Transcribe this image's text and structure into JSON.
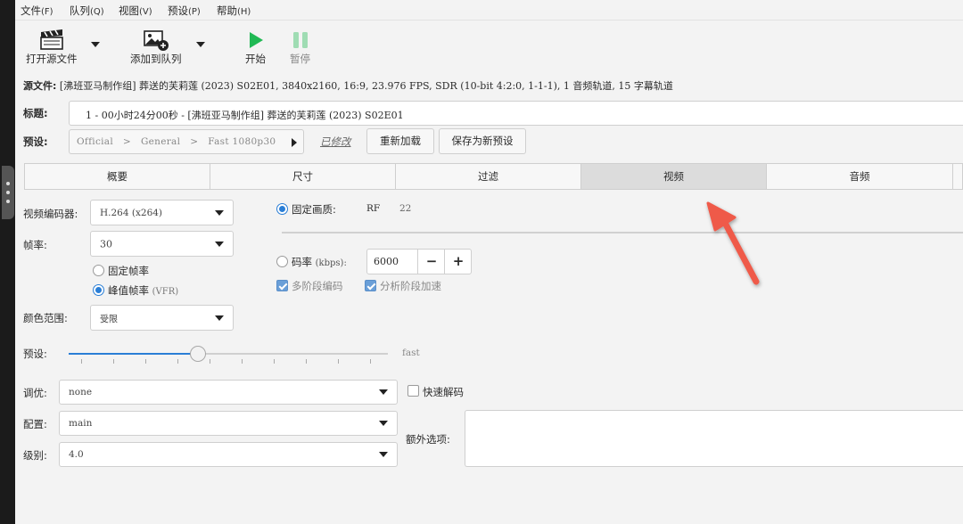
{
  "menu": [
    {
      "label": "文件",
      "accel": "(F)"
    },
    {
      "label": "队列",
      "accel": "(Q)"
    },
    {
      "label": "视图",
      "accel": "(V)"
    },
    {
      "label": "预设",
      "accel": "(P)"
    },
    {
      "label": "帮助",
      "accel": "(H)"
    }
  ],
  "toolbar": {
    "open_source": "打开源文件",
    "add_queue": "添加到队列",
    "start": "开始",
    "pause": "暂停"
  },
  "source": {
    "label": "源文件:",
    "value": "[沸班亚马制作组] 葬送的芙莉莲 (2023) S02E01, 3840x2160, 16:9, 23.976 FPS, SDR (10-bit 4:2:0, 1-1-1), 1 音频轨道, 15 字幕轨道"
  },
  "title_field": {
    "label": "标题:",
    "value": "1 - 00小时24分00秒 - [沸班亚马制作组] 葬送的芙莉莲 (2023) S02E01"
  },
  "preset": {
    "label": "预设:",
    "crumbs": [
      "Official",
      ">",
      "General",
      ">",
      "Fast 1080p30"
    ],
    "modified": "已修改",
    "reload": "重新加载",
    "save_new": "保存为新预设"
  },
  "tabs": [
    "概要",
    "尺寸",
    "过滤",
    "视频",
    "音频"
  ],
  "active_tab": "视频",
  "video": {
    "encoder_label": "视频编码器:",
    "encoder_value": "H.264 (x264)",
    "framerate_label": "帧率:",
    "framerate_value": "30",
    "constant_fr": "固定帧率",
    "peak_fr": "峰值帧率",
    "peak_fr_suffix": "(VFR)",
    "color_range_label": "颜色范围:",
    "color_range_value": "受限",
    "quality_label": "固定画质:",
    "rf_label": "RF",
    "rf_value": "22",
    "bitrate_label": "码率",
    "bitrate_unit": "(kbps):",
    "bitrate_value": "6000",
    "multipass": "多阶段编码",
    "turbo": "分析阶段加速",
    "preset_label": "预设:",
    "preset_value": "fast",
    "preset_level": 0.4,
    "tune_label": "调优:",
    "tune_value": "none",
    "fast_decode": "快速解码",
    "profile_label": "配置:",
    "profile_value": "main",
    "level_label": "级别:",
    "level_value": "4.0",
    "extra_label": "额外选项:"
  },
  "colors": {
    "accent": "#2a7ed6",
    "arrow": "#ef5a4a"
  }
}
